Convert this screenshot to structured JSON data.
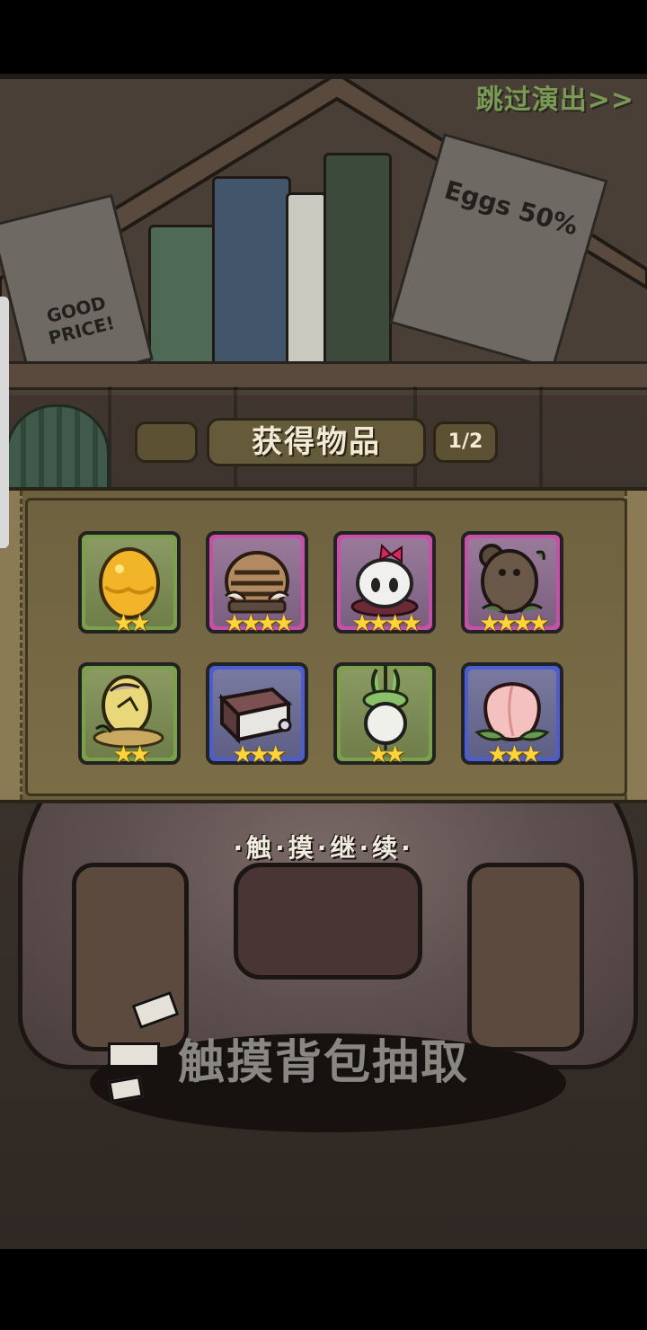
{
  "top": {
    "skip_label": "跳过演出>>"
  },
  "shelf": {
    "note_left": "GOOD PRICE!",
    "note_right": "Eggs 50%"
  },
  "header": {
    "title": "获得物品",
    "page": "1/2"
  },
  "items": [
    {
      "name": "golden-egg",
      "rarity": "green",
      "stars": 2
    },
    {
      "name": "tiger-striped-egg",
      "rarity": "pink",
      "stars": 4
    },
    {
      "name": "ribbon-egg",
      "rarity": "pink",
      "stars": 4
    },
    {
      "name": "bear-pot",
      "rarity": "pink",
      "stars": 4
    },
    {
      "name": "cracked-egg-nest",
      "rarity": "green",
      "stars": 2
    },
    {
      "name": "book",
      "rarity": "blue",
      "stars": 3
    },
    {
      "name": "radish",
      "rarity": "green",
      "stars": 2
    },
    {
      "name": "peach",
      "rarity": "blue",
      "stars": 3
    }
  ],
  "prompts": {
    "touch_continue": "·触·摸·继·续·",
    "touch_bag": "触摸背包抽取"
  },
  "colors": {
    "rarity_green": "#7aa04a",
    "rarity_pink": "#c84fa8",
    "rarity_blue": "#4a5ed0",
    "star": "#ffd43a",
    "skip": "#7a9a55"
  }
}
